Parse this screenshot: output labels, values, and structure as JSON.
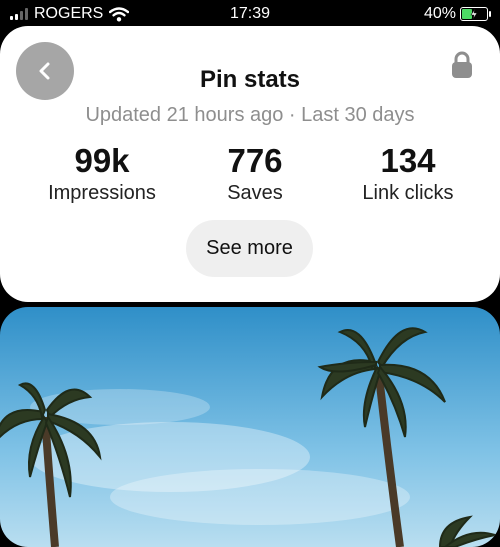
{
  "status_bar": {
    "carrier": "ROGERS",
    "time": "17:39",
    "battery_percent": "40%",
    "battery_level": 0.4
  },
  "header": {
    "title": "Pin stats",
    "subtitle": "Updated 21 hours ago · Last 30 days"
  },
  "stats": [
    {
      "value": "99k",
      "label": "Impressions"
    },
    {
      "value": "776",
      "label": "Saves"
    },
    {
      "value": "134",
      "label": "Link clicks"
    }
  ],
  "see_more_label": "See more",
  "icons": {
    "back": "chevron-left-icon",
    "lock": "lock-icon",
    "wifi": "wifi-icon",
    "battery": "battery-charging-icon"
  },
  "colors": {
    "sky": "#4aa8d8",
    "battery_fill": "#4cd964",
    "back_button": "#a6a6a6"
  }
}
